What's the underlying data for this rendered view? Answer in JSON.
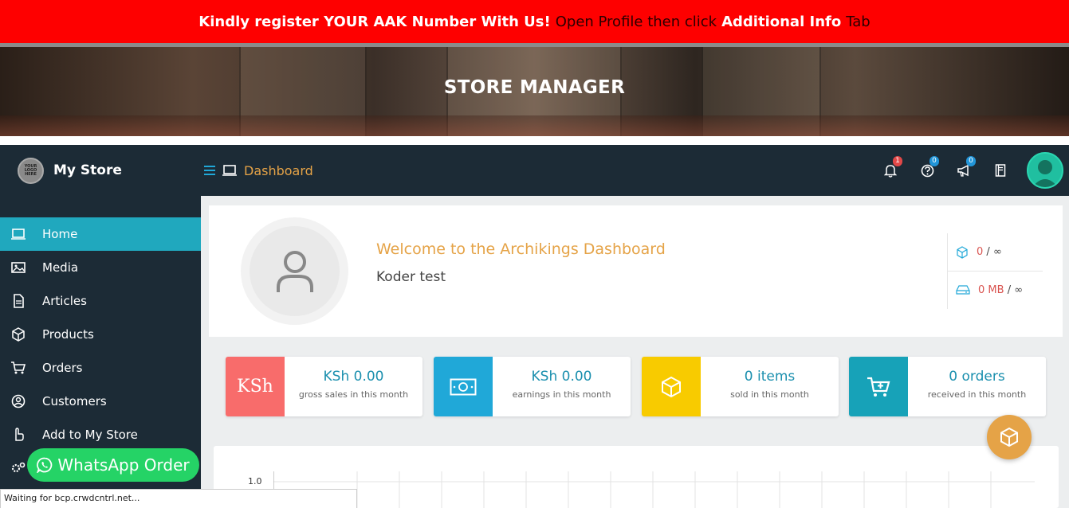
{
  "notice": {
    "part1": "Kindly register YOUR AAK Number With Us!",
    "part2": "Open Profile then click",
    "part3": "Additional Info",
    "part4": "Tab"
  },
  "banner": {
    "title": "STORE MANAGER"
  },
  "brand": {
    "logo_text": "YOUR LOGO HERE",
    "name": "My Store"
  },
  "sidebar": {
    "items": [
      {
        "label": "Home",
        "icon": "laptop-icon",
        "active": true
      },
      {
        "label": "Media",
        "icon": "image-icon"
      },
      {
        "label": "Articles",
        "icon": "file-text-icon"
      },
      {
        "label": "Products",
        "icon": "cube-icon"
      },
      {
        "label": "Orders",
        "icon": "cart-icon"
      },
      {
        "label": "Customers",
        "icon": "user-circle-icon"
      },
      {
        "label": "Add to My Store",
        "icon": "hand-pointer-icon"
      }
    ]
  },
  "topbar": {
    "breadcrumb": "Dashboard",
    "notifications_count": "1",
    "help_count": "0",
    "announcements_count": "0"
  },
  "welcome": {
    "title": "Welcome to the Archikings Dashboard",
    "user": "Koder test",
    "products_used": "0",
    "products_limit": "∞",
    "space_used": "0 MB",
    "space_limit": "∞",
    "separator": "/"
  },
  "stats": [
    {
      "icon_text": "KSh",
      "value": "KSh 0.00",
      "label": "gross sales in this month",
      "color": "#f86c6b"
    },
    {
      "icon_text": "",
      "value": "KSh 0.00",
      "label": "earnings in this month",
      "color": "#20a8d8"
    },
    {
      "icon_text": "",
      "value": "0 items",
      "label": "sold in this month",
      "color": "#f8cb00"
    },
    {
      "icon_text": "",
      "value": "0 orders",
      "label": "received in this month",
      "color": "#17a2b8"
    }
  ],
  "chart": {
    "ytick": "1.0"
  },
  "whatsapp": {
    "label": "WhatsApp Order"
  },
  "status": {
    "text": "Waiting for bcp.crwdcntrl.net..."
  }
}
